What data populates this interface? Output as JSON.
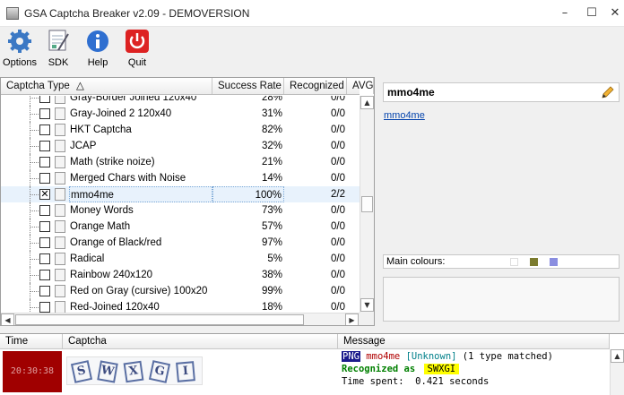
{
  "window": {
    "title": "GSA Captcha Breaker v2.09 - DEMOVERSION",
    "minimize": "–",
    "maximize": "☐",
    "close": "✕"
  },
  "toolbar": {
    "options": "Options",
    "sdk": "SDK",
    "help": "Help",
    "quit": "Quit"
  },
  "grid": {
    "columns": {
      "type": "Captcha Type",
      "sort_arrow": "△",
      "rate": "Success Rate",
      "recognized": "Recognized",
      "avg": "AVG."
    },
    "rows": [
      {
        "name": "Gray-Border Joined 120x40",
        "rate": "28%",
        "recognized": "0/0",
        "checked": false,
        "selected": false
      },
      {
        "name": "Gray-Joined 2 120x40",
        "rate": "31%",
        "recognized": "0/0",
        "checked": false,
        "selected": false
      },
      {
        "name": "HKT Captcha",
        "rate": "82%",
        "recognized": "0/0",
        "checked": false,
        "selected": false
      },
      {
        "name": "JCAP",
        "rate": "32%",
        "recognized": "0/0",
        "checked": false,
        "selected": false
      },
      {
        "name": "Math (strike noize)",
        "rate": "21%",
        "recognized": "0/0",
        "checked": false,
        "selected": false
      },
      {
        "name": "Merged Chars with Noise",
        "rate": "14%",
        "recognized": "0/0",
        "checked": false,
        "selected": false
      },
      {
        "name": "mmo4me",
        "rate": "100%",
        "recognized": "2/2",
        "checked": true,
        "selected": true
      },
      {
        "name": "Money Words",
        "rate": "73%",
        "recognized": "0/0",
        "checked": false,
        "selected": false
      },
      {
        "name": "Orange Math",
        "rate": "57%",
        "recognized": "0/0",
        "checked": false,
        "selected": false
      },
      {
        "name": "Orange of Black/red",
        "rate": "97%",
        "recognized": "0/0",
        "checked": false,
        "selected": false
      },
      {
        "name": "Radical",
        "rate": "5%",
        "recognized": "0/0",
        "checked": false,
        "selected": false
      },
      {
        "name": "Rainbow 240x120",
        "rate": "38%",
        "recognized": "0/0",
        "checked": false,
        "selected": false
      },
      {
        "name": "Red on Gray (cursive) 100x20",
        "rate": "99%",
        "recognized": "0/0",
        "checked": false,
        "selected": false
      },
      {
        "name": "Red-Joined 120x40",
        "rate": "18%",
        "recognized": "0/0",
        "checked": false,
        "selected": false
      }
    ]
  },
  "detail": {
    "name": "mmo4me",
    "link": "mmo4me",
    "main_colours_label": "Main colours:",
    "colours": [
      "#ffffff",
      "#7b7b2e",
      "#8a8ee0"
    ]
  },
  "log": {
    "columns": {
      "time": "Time",
      "captcha": "Captcha",
      "message": "Message"
    },
    "time": "20:30:38",
    "captcha_letters": [
      "S",
      "W",
      "X",
      "G",
      "I"
    ],
    "line1": {
      "badge": "PNG",
      "name": "mmo4me",
      "tag": "[Unknown]",
      "rest": "(1 type matched)"
    },
    "line2": {
      "label": "Recognized as",
      "value": "SWXGI"
    },
    "line3": "Time spent:  0.421 seconds"
  }
}
